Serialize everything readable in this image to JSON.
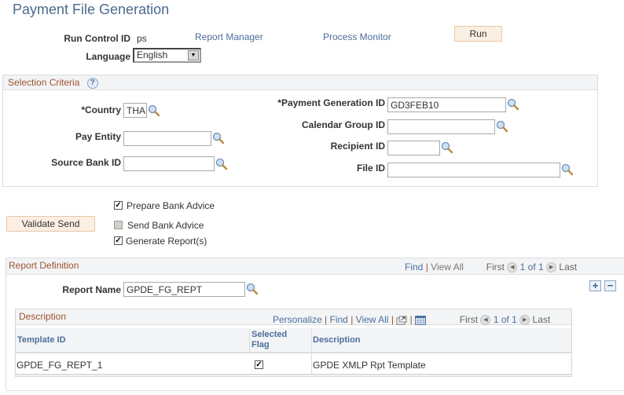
{
  "page": {
    "title": "Payment File Generation"
  },
  "run_control": {
    "run_control_id_label": "Run Control ID",
    "run_control_id_value": "ps",
    "report_manager_link": "Report Manager",
    "process_monitor_link": "Process Monitor",
    "run_button": "Run",
    "language_label": "Language",
    "language_value": "English"
  },
  "selection_criteria": {
    "header": "Selection Criteria",
    "help_icon": "?",
    "country_label": "*Country",
    "country_value": "THA",
    "pay_entity_label": "Pay Entity",
    "pay_entity_value": "",
    "source_bank_label": "Source Bank ID",
    "source_bank_value": "",
    "payment_generation_label": "*Payment Generation ID",
    "payment_generation_value": "GD3FEB10",
    "calendar_group_label": "Calendar Group ID",
    "calendar_group_value": "",
    "recipient_label": "Recipient ID",
    "recipient_value": "",
    "file_id_label": "File ID",
    "file_id_value": ""
  },
  "options": {
    "validate_send_button": "Validate Send",
    "prepare_bank_advice": {
      "label": "Prepare Bank Advice",
      "checked": true
    },
    "send_bank_advice": {
      "label": "Send Bank Advice",
      "checked": false,
      "disabled": true
    },
    "generate_reports": {
      "label": "Generate Report(s)",
      "checked": true
    }
  },
  "report_definition": {
    "header": "Report Definition",
    "find": "Find",
    "sep": "|",
    "view_all": "View All",
    "first": "First",
    "pagination": "1 of 1",
    "last": "Last",
    "report_name_label": "Report Name",
    "report_name_value": "GPDE_FG_REPT",
    "add_row": "+",
    "delete_row": "−"
  },
  "description_grid": {
    "header": "Description",
    "personalize": "Personalize",
    "find": "Find",
    "view_all": "View All",
    "sep": "|",
    "first": "First",
    "pagination": "1 of 1",
    "last": "Last",
    "columns": [
      "Template ID",
      "Selected Flag",
      "Description"
    ],
    "rows": [
      {
        "template_id": "GPDE_FG_REPT_1",
        "selected": true,
        "description": "GPDE XMLP Rpt Template"
      }
    ]
  }
}
